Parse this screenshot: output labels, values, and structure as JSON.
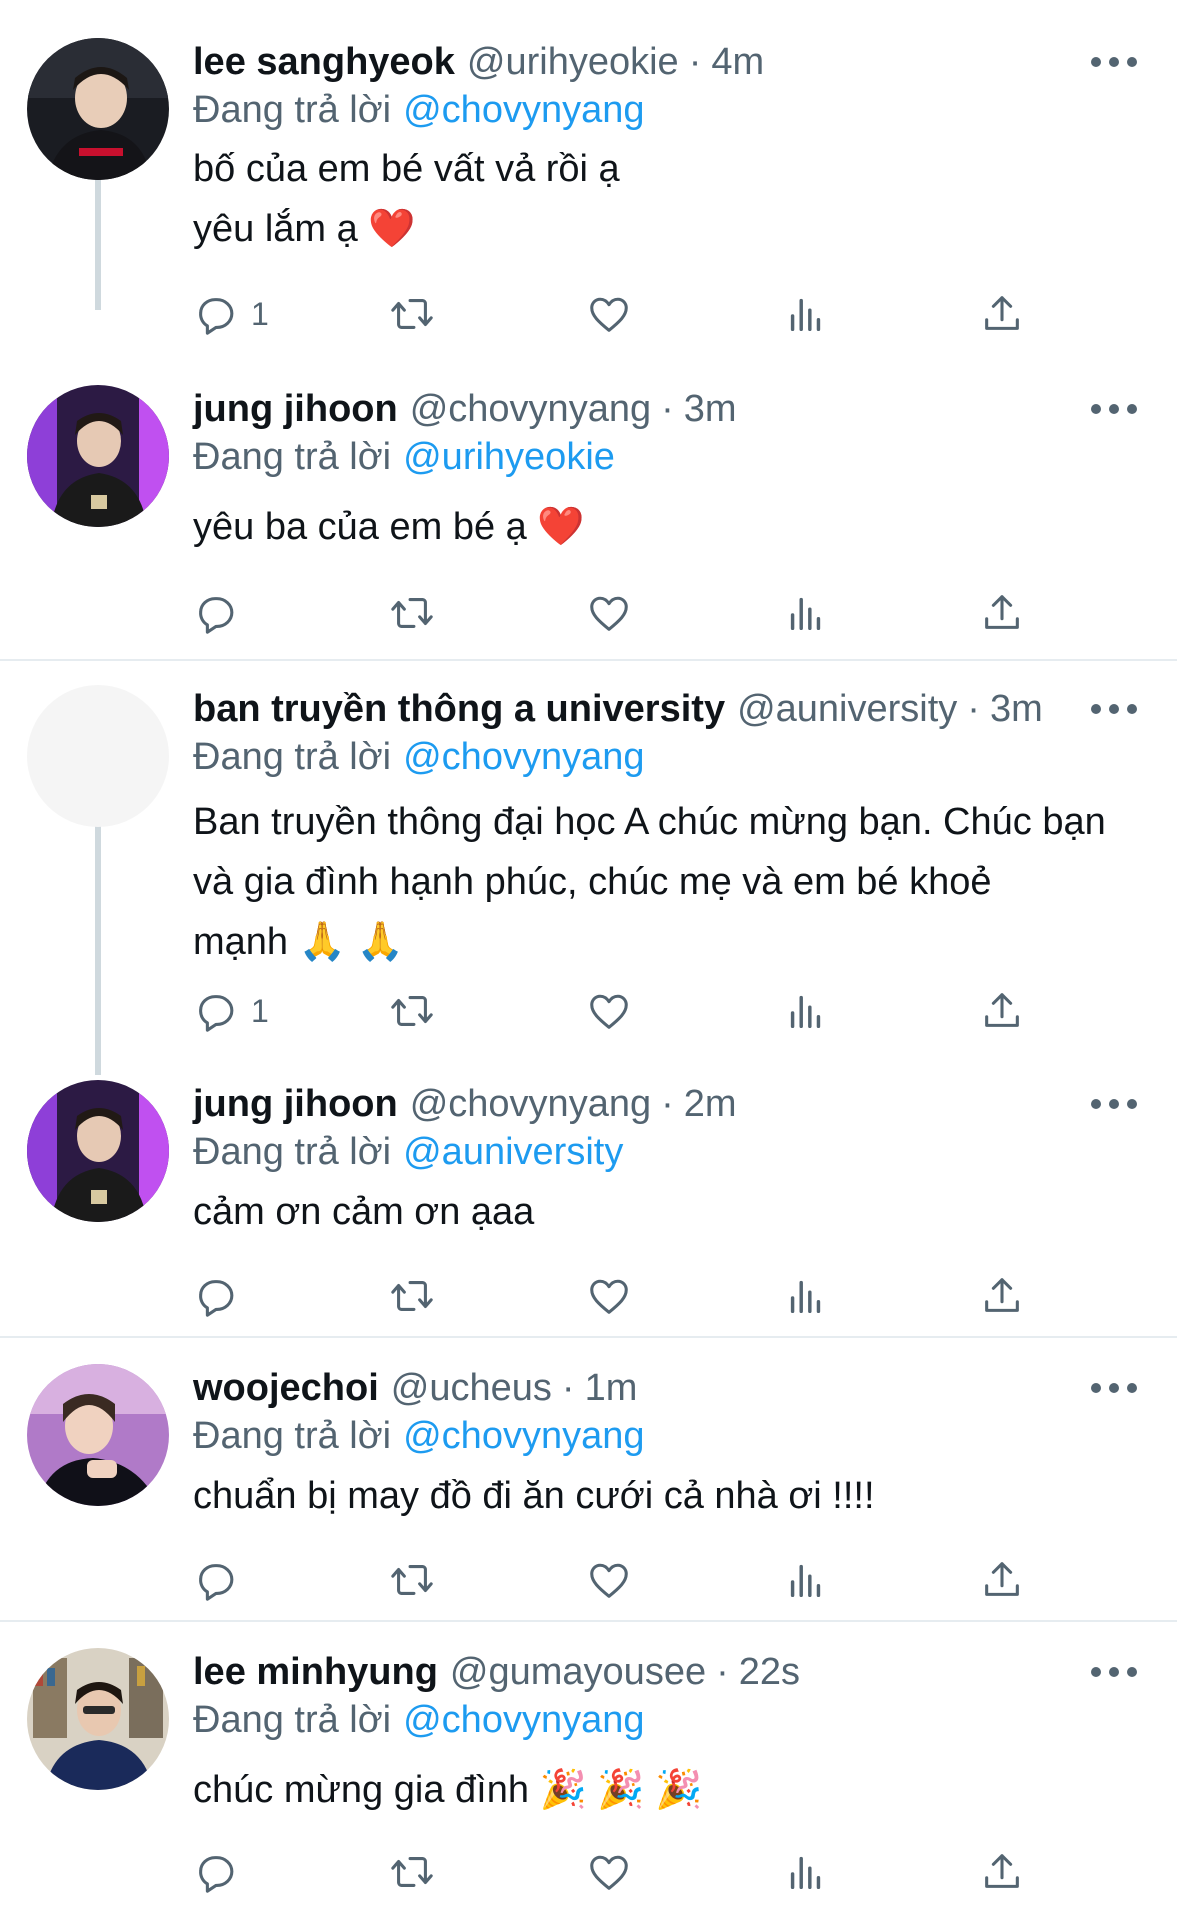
{
  "icons": {
    "reply": "reply-icon",
    "retweet": "retweet-icon",
    "like": "heart-icon",
    "views": "views-icon",
    "share": "share-icon",
    "more": "more-icon"
  },
  "tweets": [
    {
      "name": "lee sanghyeok",
      "handle": "@urihyeokie",
      "time": "4m",
      "replying_label": "Đang trả lời",
      "replying_to": "@chovynyang",
      "lines": [
        "bố của em bé vất vả rồi ạ",
        "yêu lắm ạ ❤️"
      ],
      "reply_count": "1"
    },
    {
      "name": "jung jihoon",
      "handle": "@chovynyang",
      "time": "3m",
      "replying_label": "Đang trả lời",
      "replying_to": "@urihyeokie",
      "lines": [
        "yêu ba của em bé ạ ❤️"
      ],
      "reply_count": ""
    },
    {
      "name": "ban truyền thông a university",
      "handle": "@auniversity",
      "time": "3m",
      "replying_label": "Đang trả lời",
      "replying_to": "@chovynyang",
      "lines": [
        "Ban truyền thông đại học A chúc mừng bạn. Chúc bạn và gia đình hạnh phúc, chúc mẹ và em bé khoẻ",
        "mạnh 🙏 🙏"
      ],
      "reply_count": "1"
    },
    {
      "name": "jung jihoon",
      "handle": "@chovynyang",
      "time": "2m",
      "replying_label": "Đang trả lời",
      "replying_to": "@auniversity",
      "lines": [
        "cảm ơn cảm ơn ạaa"
      ],
      "reply_count": ""
    },
    {
      "name": "woojechoi",
      "handle": "@ucheus",
      "time": "1m",
      "replying_label": "Đang trả lời",
      "replying_to": "@chovynyang",
      "lines": [
        "chuẩn bị may đồ đi ăn cưới cả nhà ơi !!!!"
      ],
      "reply_count": ""
    },
    {
      "name": "lee minhyung",
      "handle": "@gumayousee",
      "time": "22s",
      "replying_label": "Đang trả lời",
      "replying_to": "@chovynyang",
      "lines": [
        "chúc mừng gia đình 🎉 🎉 🎉"
      ],
      "reply_count": ""
    }
  ]
}
